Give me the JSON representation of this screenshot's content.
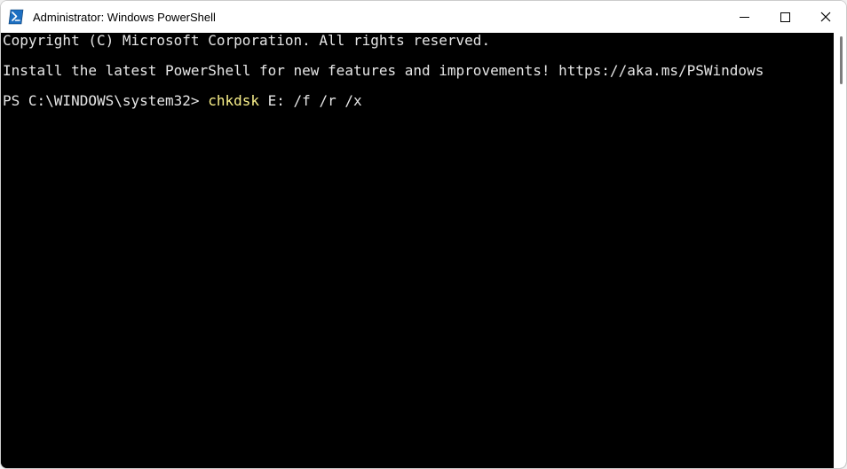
{
  "window": {
    "title": "Administrator: Windows PowerShell"
  },
  "icons": {
    "app": "powershell-icon",
    "minimize": "minimize-icon",
    "maximize": "maximize-icon",
    "close": "close-icon"
  },
  "terminal": {
    "lines": {
      "copyright": "Copyright (C) Microsoft Corporation. All rights reserved.",
      "install_msg": "Install the latest PowerShell for new features and improvements! https://aka.ms/PSWindows",
      "prompt": "PS C:\\WINDOWS\\system32>",
      "command_yellow": "chkdsk",
      "command_rest": "E: /f /r /x"
    }
  }
}
